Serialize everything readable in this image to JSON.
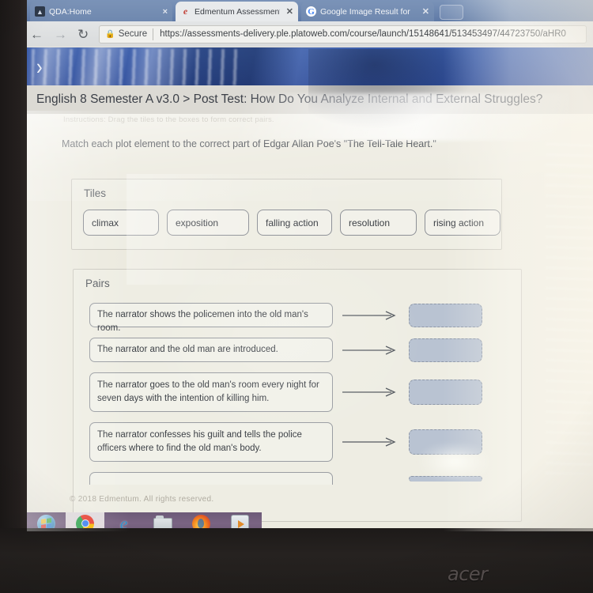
{
  "browser": {
    "tabs": [
      {
        "title": "QDA:Home",
        "favicon": "qda-icon",
        "active": false,
        "close_label": "×"
      },
      {
        "title": "Edmentum Assessments",
        "favicon": "edmentum-icon",
        "active": true,
        "close_label": "✕"
      },
      {
        "title": "Google Image Result for",
        "favicon": "google-icon",
        "active": false,
        "close_label": "✕"
      }
    ],
    "new_tab_label": "",
    "nav": {
      "back_glyph": "←",
      "forward_glyph": "→",
      "reload_glyph": "↻"
    },
    "omnibox": {
      "lock_glyph": "🔒",
      "security_label": "Secure",
      "url": "https://assessments-delivery.ple.platoweb.com/course/launch/15148641/513453497/44723750/aHR0"
    }
  },
  "app": {
    "header": {
      "expand_glyph": "›",
      "accent_color": "#3455a3"
    },
    "breadcrumb": "English 8 Semester A v3.0 > Post Test: How Do You Analyze Internal and External Struggles?",
    "sub_instruction": "Instructions: Drag the tiles to the boxes to form correct pairs.",
    "instruction": "Match each plot element to the correct part of Edgar Allan Poe's \"The Tell-Tale Heart.\"",
    "tiles_panel": {
      "label": "Tiles",
      "tiles": [
        {
          "label": "climax"
        },
        {
          "label": "exposition"
        },
        {
          "label": "falling action"
        },
        {
          "label": "resolution"
        },
        {
          "label": "rising action"
        }
      ]
    },
    "pairs_panel": {
      "label": "Pairs",
      "arrow_glyph": "⟶",
      "rows": [
        {
          "text": "The narrator shows the policemen into the old man's room.",
          "lines": 1,
          "drop_value": ""
        },
        {
          "text": "The narrator and the old man are introduced.",
          "lines": 1,
          "drop_value": ""
        },
        {
          "text": "The narrator goes to the old man's room every night for seven days with the intention of killing him.",
          "lines": 2,
          "drop_value": ""
        },
        {
          "text": "The narrator confesses his guilt and tells the police officers where to find the old man's body.",
          "lines": 2,
          "drop_value": ""
        },
        {
          "text": "",
          "lines": 1,
          "drop_value": ""
        }
      ]
    },
    "footer": "© 2018 Edmentum. All rights reserved."
  },
  "taskbar": {
    "items": [
      {
        "icon": "windows-start-icon",
        "name": "start-button"
      },
      {
        "icon": "chrome-icon",
        "name": "taskbar-chrome"
      },
      {
        "icon": "internet-explorer-icon",
        "name": "taskbar-internet-explorer"
      },
      {
        "icon": "file-explorer-icon",
        "name": "taskbar-file-explorer"
      },
      {
        "icon": "firefox-icon",
        "name": "taskbar-firefox"
      },
      {
        "icon": "media-player-icon",
        "name": "taskbar-media-player"
      }
    ]
  },
  "device": {
    "brand": "acer"
  }
}
